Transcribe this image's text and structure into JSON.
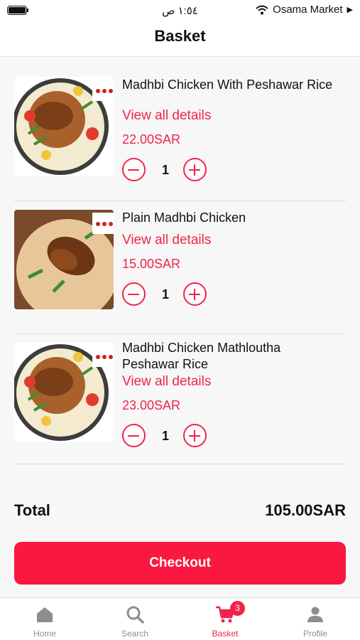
{
  "status_bar": {
    "time": "١:٥٤ ص",
    "carrier": "Osama Market",
    "play_glyph": "▶"
  },
  "header": {
    "title": "Basket"
  },
  "cart": {
    "items": [
      {
        "name": "Madhbi Chicken With Peshawar Rice",
        "details_link": "View all details",
        "price": "22.00SAR",
        "quantity": "1",
        "image": "chicken-rice-platter"
      },
      {
        "name": "Plain Madhbi Chicken",
        "details_link": "View all details",
        "price": "15.00SAR",
        "quantity": "1",
        "image": "chicken-board"
      },
      {
        "name": "Madhbi Chicken Mathloutha Peshawar Rice",
        "details_link": "View all details",
        "price": "23.00SAR",
        "quantity": "1",
        "image": "chicken-rice-platter"
      }
    ]
  },
  "summary": {
    "total_label": "Total",
    "total_value": "105.00SAR"
  },
  "checkout": {
    "label": "Checkout"
  },
  "tabbar": {
    "tabs": [
      {
        "label": "Home",
        "icon": "home-icon",
        "active": false
      },
      {
        "label": "Search",
        "icon": "search-icon",
        "active": false
      },
      {
        "label": "Basket",
        "icon": "cart-icon",
        "active": true,
        "badge": "3"
      },
      {
        "label": "Profile",
        "icon": "person-icon",
        "active": false
      }
    ]
  },
  "colors": {
    "accent": "#f0244a",
    "checkout_bg": "#f9183f",
    "inactive_tab": "#8e8e8e",
    "background": "#f7f7f7"
  }
}
